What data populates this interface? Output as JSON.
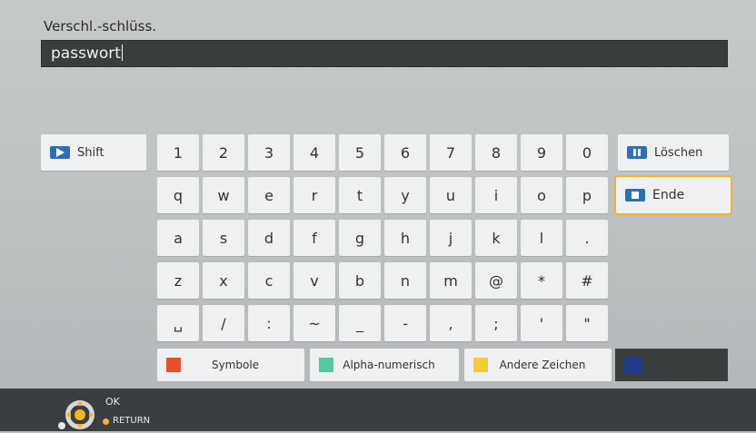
{
  "field": {
    "label": "Verschl.-schlüss.",
    "value": "passwort"
  },
  "side": {
    "shift": "Shift",
    "delete": "Löschen",
    "end": "Ende"
  },
  "keys": {
    "row1": [
      "1",
      "2",
      "3",
      "4",
      "5",
      "6",
      "7",
      "8",
      "9",
      "0"
    ],
    "row2": [
      "q",
      "w",
      "e",
      "r",
      "t",
      "y",
      "u",
      "i",
      "o",
      "p"
    ],
    "row3": [
      "a",
      "s",
      "d",
      "f",
      "g",
      "h",
      "j",
      "k",
      "l",
      "."
    ],
    "row4": [
      "z",
      "x",
      "c",
      "v",
      "b",
      "n",
      "m",
      "@",
      "*",
      "#"
    ],
    "row5": [
      "␣",
      "/",
      ":",
      "~",
      "_",
      "-",
      ",",
      ";",
      "'",
      "\""
    ]
  },
  "color_buttons": [
    {
      "label": "Symbole",
      "color": "#e8502d"
    },
    {
      "label": "Alpha-numerisch",
      "color": "#52c9a0"
    },
    {
      "label": "Andere Zeichen",
      "color": "#f3cc35"
    }
  ],
  "blue_color": "#1f3c8a",
  "footer": {
    "ok": "OK",
    "return": "RETURN"
  },
  "colors": {
    "focus": "#f0b42a",
    "button_icon": "#2d6fb6"
  }
}
